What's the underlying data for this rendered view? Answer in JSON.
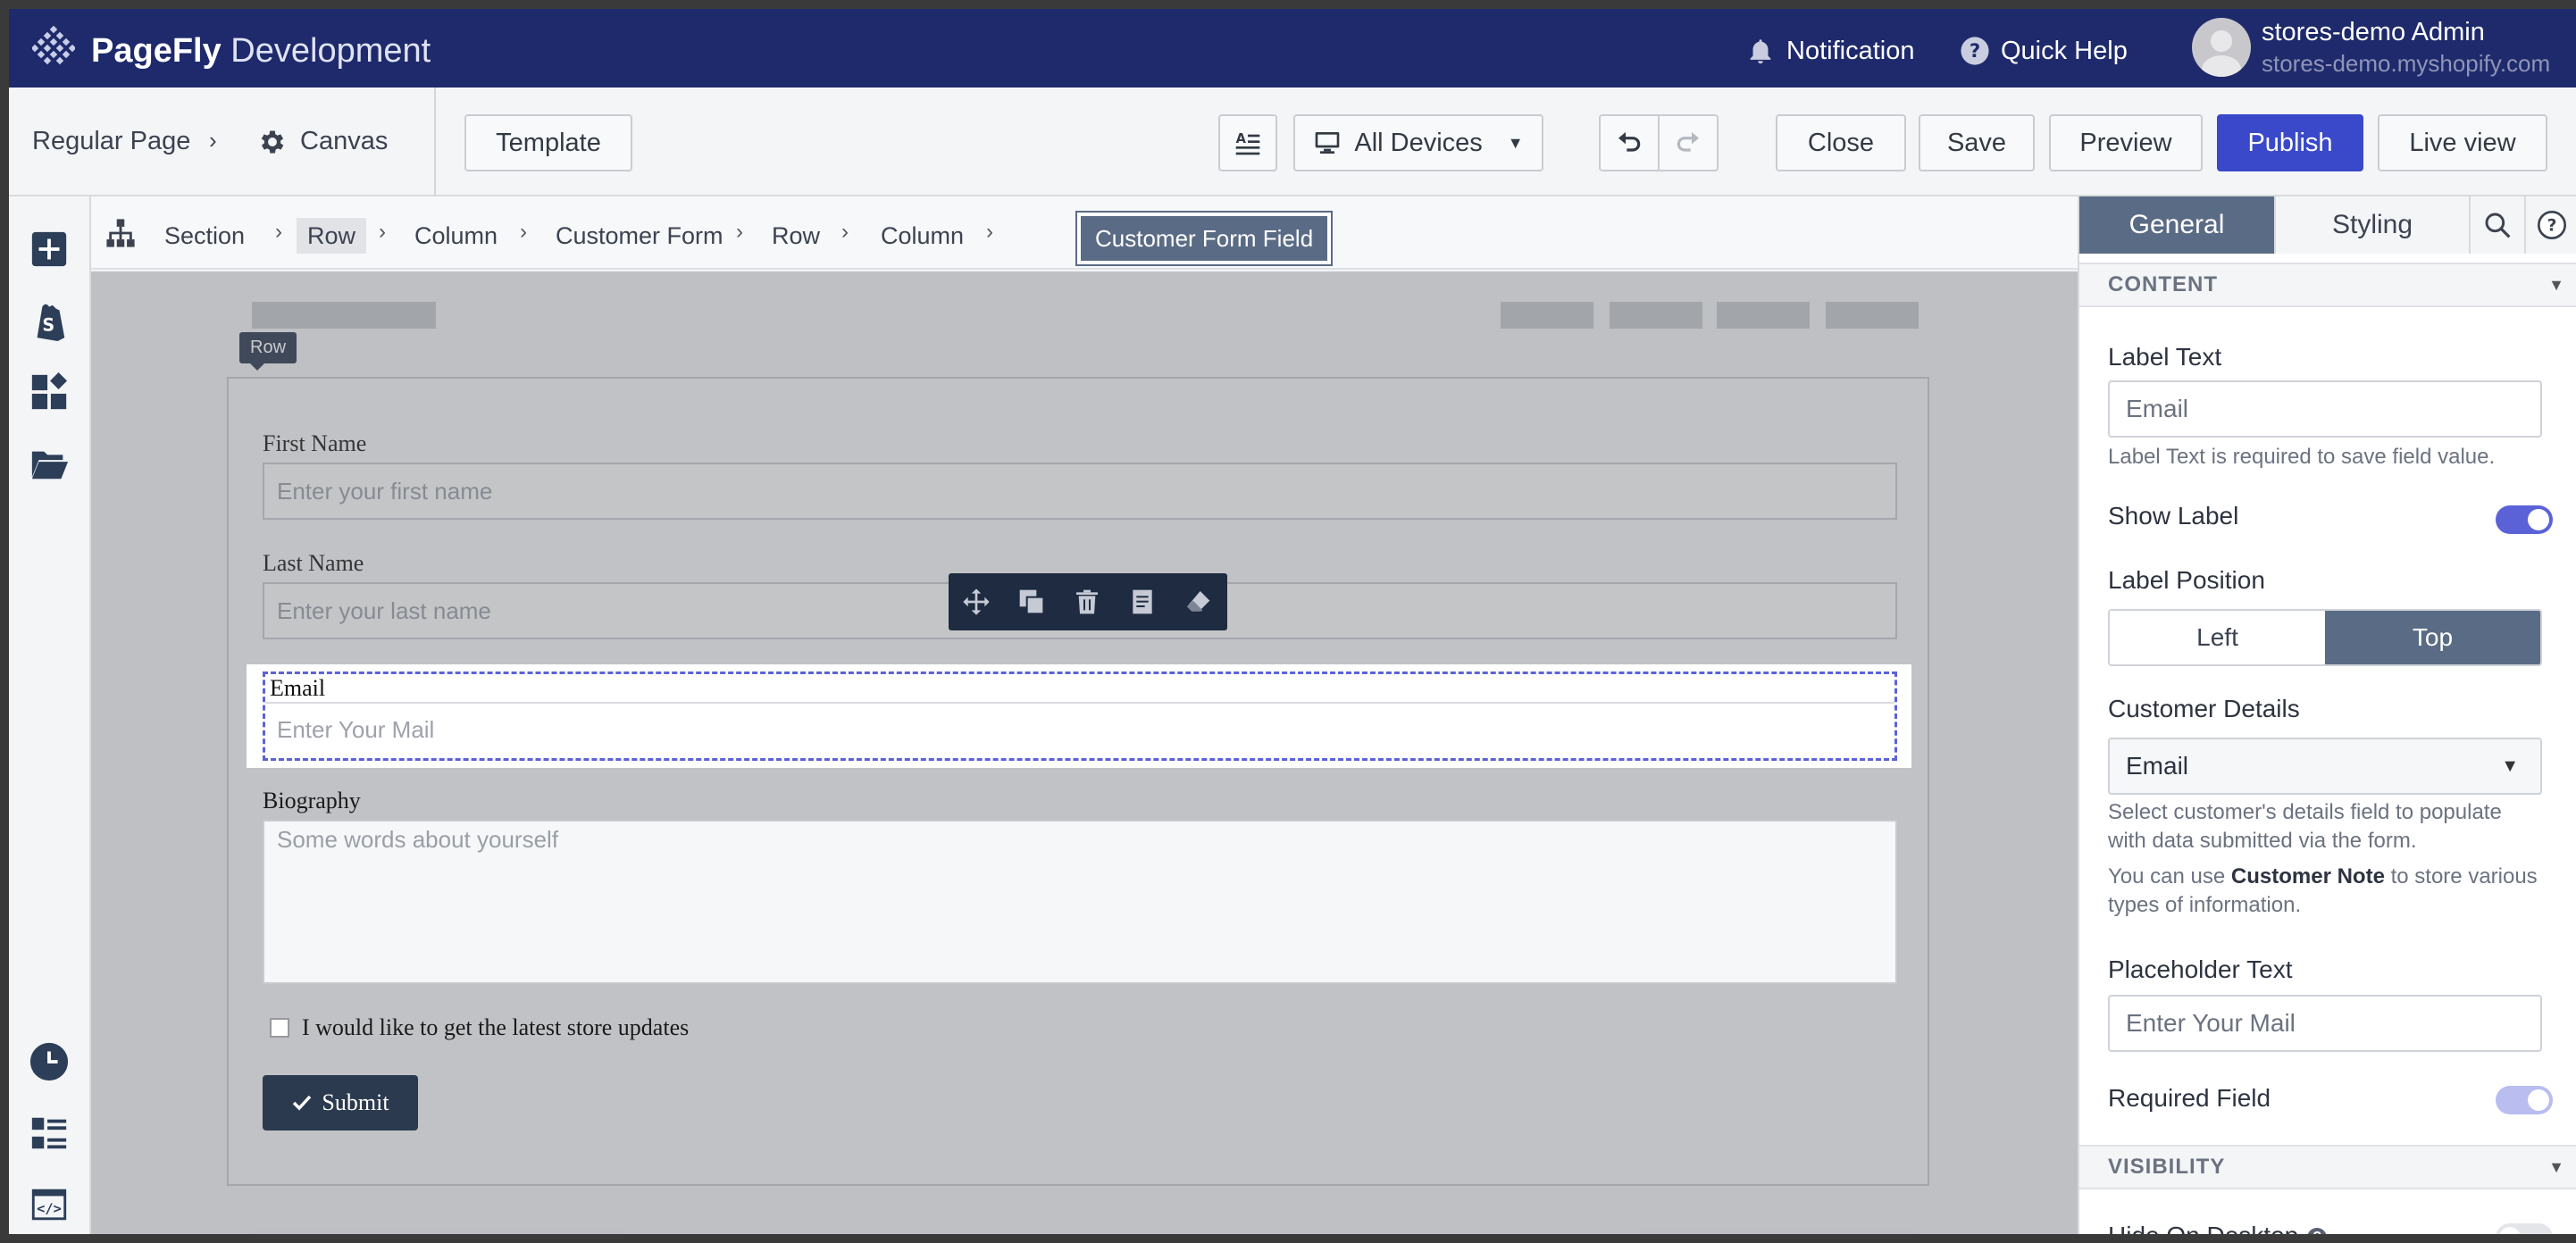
{
  "topbar": {
    "brand_bold": "PageFly",
    "brand_rest": " Development",
    "notification": "Notification",
    "quick_help": "Quick Help",
    "user_name": "stores-demo Admin",
    "user_store": "stores-demo.myshopify.com"
  },
  "toolbar": {
    "regular_page": "Regular Page",
    "canvas": "Canvas",
    "template": "Template",
    "devices": "All Devices",
    "close": "Close",
    "save": "Save",
    "preview": "Preview",
    "publish": "Publish",
    "live_view": "Live view"
  },
  "breadcrumb": {
    "items": [
      "Section",
      "Row",
      "Column",
      "Customer Form",
      "Row",
      "Column"
    ],
    "active": "Customer Form Field"
  },
  "canvas": {
    "row_tag": "Row",
    "first_name_label": "First Name",
    "first_name_placeholder": "Enter your first name",
    "last_name_label": "Last Name",
    "last_name_placeholder": "Enter your last name",
    "email_label": "Email",
    "email_placeholder": "Enter Your Mail",
    "bio_label": "Biography",
    "bio_placeholder": "Some words about yourself",
    "checkbox_label": "I would like to get the latest store updates",
    "submit": "Submit"
  },
  "panel": {
    "tab_general": "General",
    "tab_styling": "Styling",
    "content_header": "CONTENT",
    "label_text_label": "Label Text",
    "label_text_value": "Email",
    "label_text_help": "Label Text is required to save field value.",
    "show_label": "Show Label",
    "show_label_on": true,
    "label_position": "Label Position",
    "pos_left": "Left",
    "pos_top": "Top",
    "customer_details": "Customer Details",
    "customer_details_value": "Email",
    "customer_help_1": "Select customer's details field to populate with data submitted via the form.",
    "customer_help_2a": "You can use ",
    "customer_help_2b": "Customer Note",
    "customer_help_2c": " to store various types of information.",
    "placeholder_text": "Placeholder Text",
    "placeholder_value": "Enter Your Mail",
    "required_field": "Required Field",
    "required_on": true,
    "visibility_header": "VISIBILITY",
    "hide_on_desktop": "Hide On Desktop",
    "hide_on_desktop_on": false
  },
  "colors": {
    "topbar": "#1e2a6b",
    "publish": "#3949c9",
    "accent": "#5b62d8",
    "active_tab": "#5a6b85"
  }
}
